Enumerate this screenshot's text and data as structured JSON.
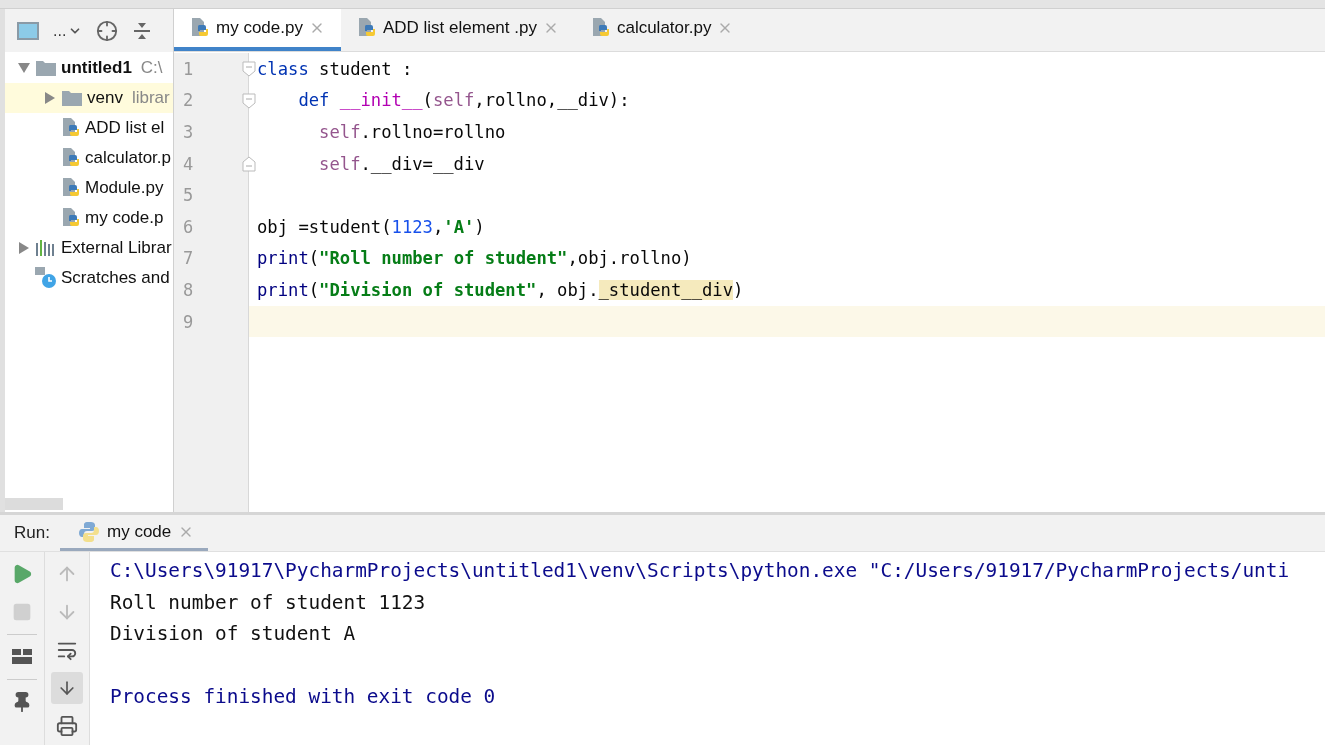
{
  "project_toolbar": {
    "dropdown_label": "..."
  },
  "project_tree": [
    {
      "label": "untitled1",
      "hint": "C:\\",
      "kind": "root",
      "selected": false,
      "expanded": true,
      "children": [
        {
          "label": "venv",
          "hint": "librar",
          "kind": "folder",
          "selected": true,
          "expanded": false
        },
        {
          "label": "ADD list el",
          "kind": "file",
          "selected": false
        },
        {
          "label": "calculator.p",
          "kind": "file",
          "selected": false
        },
        {
          "label": "Module.py",
          "kind": "file",
          "selected": false
        },
        {
          "label": "my code.p",
          "kind": "file",
          "selected": false
        }
      ]
    },
    {
      "label": "External Librar",
      "kind": "library",
      "selected": false,
      "expanded": false
    },
    {
      "label": "Scratches and",
      "kind": "scratch",
      "selected": false
    }
  ],
  "editor_tabs": [
    {
      "label": "my code.py",
      "selected": true
    },
    {
      "label": "ADD list element .py",
      "selected": false
    },
    {
      "label": "calculator.py",
      "selected": false
    }
  ],
  "code_lines": [
    {
      "number": "1",
      "fold_start": true,
      "fold_end": false,
      "current": false,
      "tokens": [
        {
          "text": "class",
          "kind": "keyword"
        },
        {
          "text": " student :",
          "kind": "plain"
        }
      ]
    },
    {
      "number": "2",
      "fold_start": true,
      "fold_end": false,
      "current": false,
      "tokens": [
        {
          "text": "    def",
          "kind": "keyword"
        },
        {
          "text": " __init__",
          "kind": "magic"
        },
        {
          "text": "(",
          "kind": "plain"
        },
        {
          "text": "self",
          "kind": "self"
        },
        {
          "text": ",rollno,__div):",
          "kind": "plain"
        }
      ]
    },
    {
      "number": "3",
      "fold_start": false,
      "fold_end": false,
      "current": false,
      "tokens": [
        {
          "text": "      self",
          "kind": "self"
        },
        {
          "text": ".rollno=rollno",
          "kind": "plain"
        }
      ]
    },
    {
      "number": "4",
      "fold_start": false,
      "fold_end": true,
      "current": false,
      "tokens": [
        {
          "text": "      self",
          "kind": "self"
        },
        {
          "text": ".__div=__div",
          "kind": "plain"
        }
      ]
    },
    {
      "number": "5",
      "fold_start": false,
      "fold_end": false,
      "current": false
    },
    {
      "number": "6",
      "fold_start": false,
      "fold_end": false,
      "current": false,
      "tokens": [
        {
          "text": "obj =student(",
          "kind": "plain"
        },
        {
          "text": "1123",
          "kind": "number"
        },
        {
          "text": ",",
          "kind": "plain"
        },
        {
          "text": "'A'",
          "kind": "string"
        },
        {
          "text": ")",
          "kind": "plain"
        }
      ]
    },
    {
      "number": "7",
      "fold_start": false,
      "fold_end": false,
      "current": false,
      "tokens": [
        {
          "text": "print",
          "kind": "builtin"
        },
        {
          "text": "(",
          "kind": "plain"
        },
        {
          "text": "\"Roll number of student\"",
          "kind": "string"
        },
        {
          "text": ",obj.rollno)",
          "kind": "plain"
        }
      ]
    },
    {
      "number": "8",
      "fold_start": false,
      "fold_end": false,
      "current": false,
      "tokens": [
        {
          "text": "print",
          "kind": "builtin"
        },
        {
          "text": "(",
          "kind": "plain"
        },
        {
          "text": "\"Division of student\"",
          "kind": "string"
        },
        {
          "text": ", obj.",
          "kind": "plain"
        },
        {
          "text": "_student__div",
          "kind": "highlight"
        },
        {
          "text": ")",
          "kind": "plain"
        }
      ]
    },
    {
      "number": "9",
      "fold_start": false,
      "fold_end": false,
      "current": true
    }
  ],
  "run_panel": {
    "label": "Run:",
    "tabs": [
      {
        "label": "my code",
        "selected": true
      }
    ],
    "console": [
      {
        "text": "C:\\Users\\91917\\PycharmProjects\\untitled1\\venv\\Scripts\\python.exe \"C:/Users/91917/PycharmProjects/unti",
        "kind": "system"
      },
      {
        "text": "Roll number of student 1123",
        "kind": "output"
      },
      {
        "text": "Division of student A",
        "kind": "output"
      },
      {
        "kind": "blank"
      },
      {
        "text": "Process finished with exit code 0",
        "kind": "system"
      }
    ]
  }
}
